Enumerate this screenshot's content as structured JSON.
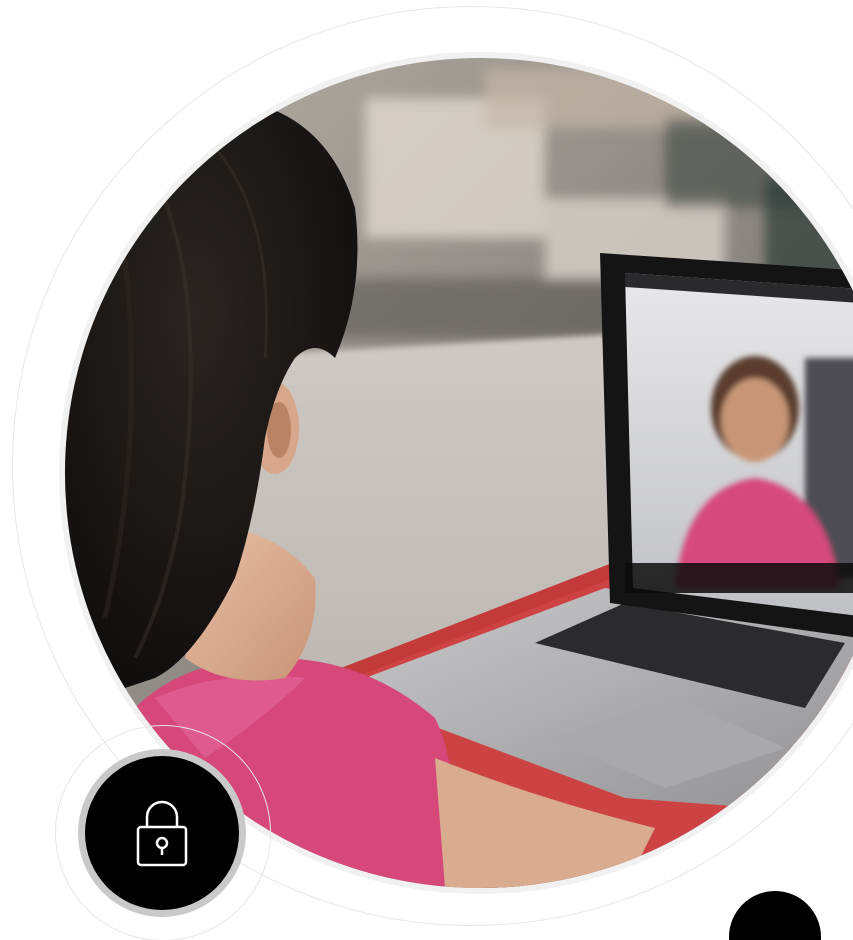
{
  "scene": {
    "photo_subject": "",
    "icons": {
      "badge_icon": "lock-icon"
    },
    "colors": {
      "background": "#ffffff",
      "badge_fill": "#000000",
      "badge_border": "#c9c9c9",
      "ring_stroke": "#e7e7e7",
      "shirt_pink": "#d6487a",
      "laptop_silver": "#b8b8b8"
    }
  }
}
